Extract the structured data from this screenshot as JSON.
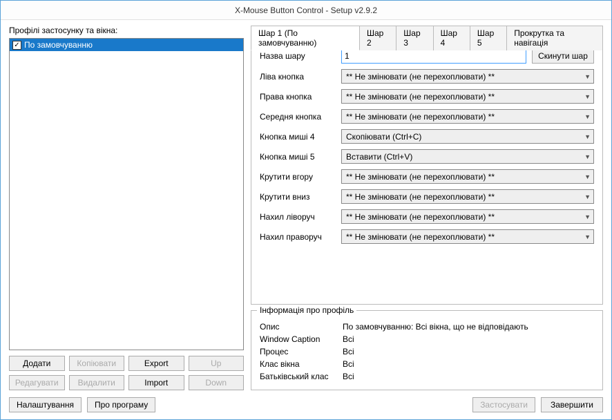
{
  "window": {
    "title": "X-Mouse Button Control - Setup v2.9.2"
  },
  "left": {
    "label": "Профілі застосунку та вікна:",
    "profile": "По замовчуванню",
    "buttons": {
      "add": "Додати",
      "copy": "Копіювати",
      "export": "Export",
      "up": "Up",
      "edit": "Редагувати",
      "delete": "Видалити",
      "import": "Import",
      "down": "Down"
    }
  },
  "tabs": {
    "t1": "Шар 1 (По замовчуванню)",
    "t2": "Шар 2",
    "t3": "Шар 3",
    "t4": "Шар 4",
    "t5": "Шар 5",
    "t6": "Прокрутка та навігація"
  },
  "form": {
    "layer_name_label": "Назва шару",
    "layer_name_value": "1",
    "reset": "Скинути шар",
    "rows": {
      "left_btn": {
        "label": "Ліва кнопка",
        "value": "** Не змінювати (не перехоплювати) **"
      },
      "right_btn": {
        "label": "Права кнопка",
        "value": "** Не змінювати (не перехоплювати) **"
      },
      "middle_btn": {
        "label": "Середня кнопка",
        "value": "** Не змінювати (не перехоплювати) **"
      },
      "mouse4": {
        "label": "Кнопка миші 4",
        "value": "Скопіювати (Ctrl+C)"
      },
      "mouse5": {
        "label": "Кнопка миші 5",
        "value": "Вставити (Ctrl+V)"
      },
      "scroll_up": {
        "label": "Крутити вгору",
        "value": "** Не змінювати (не перехоплювати) **"
      },
      "scroll_down": {
        "label": "Крутити вниз",
        "value": "** Не змінювати (не перехоплювати) **"
      },
      "tilt_left": {
        "label": "Нахил ліворуч",
        "value": "** Не змінювати (не перехоплювати) **"
      },
      "tilt_right": {
        "label": "Нахил праворуч",
        "value": "** Не змінювати (не перехоплювати) **"
      }
    }
  },
  "info": {
    "title": "Інформація про профіль",
    "desc_label": "Опис",
    "desc_value": "По замовчуванню: Всі вікна, що не відповідають",
    "caption_label": "Window Caption",
    "caption_value": "Всі",
    "process_label": "Процес",
    "process_value": "Всі",
    "class_label": "Клас вікна",
    "class_value": "Всі",
    "parent_label": "Батьківський клас",
    "parent_value": "Всі"
  },
  "bottom": {
    "settings": "Налаштування",
    "about": "Про програму",
    "apply": "Застосувати",
    "close": "Завершити"
  }
}
